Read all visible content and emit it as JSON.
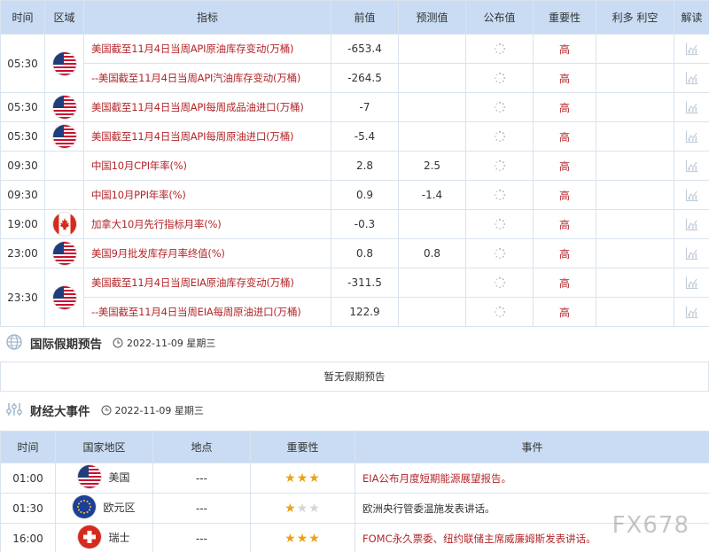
{
  "econ": {
    "headers": [
      "时间",
      "区域",
      "指标",
      "前值",
      "预测值",
      "公布值",
      "重要性",
      "利多 利空",
      "解读"
    ],
    "groups": [
      {
        "time": "05:30",
        "flag": "us-flag",
        "rows": [
          {
            "indicator": "美国截至11月4日当周API原油库存变动(万桶)",
            "prev": "-653.4",
            "forecast": "",
            "importance": "高"
          },
          {
            "indicator": "--美国截至11月4日当周API汽油库存变动(万桶)",
            "prev": "-264.5",
            "forecast": "",
            "importance": "高"
          }
        ]
      },
      {
        "time": "05:30",
        "flag": "us-flag",
        "rows": [
          {
            "indicator": "美国截至11月4日当周API每周成品油进口(万桶)",
            "prev": "-7",
            "forecast": "",
            "importance": "高"
          }
        ]
      },
      {
        "time": "05:30",
        "flag": "us-flag",
        "rows": [
          {
            "indicator": "美国截至11月4日当周API每周原油进口(万桶)",
            "prev": "-5.4",
            "forecast": "",
            "importance": "高"
          }
        ]
      },
      {
        "time": "09:30",
        "flag": "",
        "rows": [
          {
            "indicator": "中国10月CPI年率(%)",
            "prev": "2.8",
            "forecast": "2.5",
            "importance": "高"
          }
        ]
      },
      {
        "time": "09:30",
        "flag": "",
        "rows": [
          {
            "indicator": "中国10月PPI年率(%)",
            "prev": "0.9",
            "forecast": "-1.4",
            "importance": "高"
          }
        ]
      },
      {
        "time": "19:00",
        "flag": "ca-flag",
        "rows": [
          {
            "indicator": "加拿大10月先行指标月率(%)",
            "prev": "-0.3",
            "forecast": "",
            "importance": "高"
          }
        ]
      },
      {
        "time": "23:00",
        "flag": "us-flag",
        "rows": [
          {
            "indicator": "美国9月批发库存月率终值(%)",
            "prev": "0.8",
            "forecast": "0.8",
            "importance": "高"
          }
        ]
      },
      {
        "time": "23:30",
        "flag": "us-flag",
        "rows": [
          {
            "indicator": "美国截至11月4日当周EIA原油库存变动(万桶)",
            "prev": "-311.5",
            "forecast": "",
            "importance": "高"
          },
          {
            "indicator": "--美国截至11月4日当周EIA每周原油进口(万桶)",
            "prev": "122.9",
            "forecast": "",
            "importance": "高"
          }
        ]
      }
    ]
  },
  "holiday": {
    "icon": "globe-icon",
    "title": "国际假期预告",
    "date": "2022-11-09 星期三",
    "empty_text": "暂无假期预告"
  },
  "events": {
    "icon": "sliders-icon",
    "title": "财经大事件",
    "date": "2022-11-09 星期三",
    "headers": [
      "时间",
      "国家地区",
      "地点",
      "重要性",
      "事件"
    ],
    "rows": [
      {
        "time": "01:00",
        "flag": "us-flag",
        "country": "美国",
        "place": "---",
        "stars": 3,
        "event": "EIA公布月度短期能源展望报告。",
        "highlight": true
      },
      {
        "time": "01:30",
        "flag": "eu-flag",
        "country": "欧元区",
        "place": "---",
        "stars": 1,
        "event": "欧洲央行管委温施发表讲话。",
        "highlight": false
      },
      {
        "time": "16:00",
        "flag": "ch-flag",
        "country": "瑞士",
        "place": "---",
        "stars": 3,
        "event": "FOMC永久票委、纽约联储主席威廉姆斯发表讲话。",
        "highlight": true
      }
    ]
  },
  "watermark": "FX678",
  "colors": {
    "header_bg": "#c9dcf3",
    "highlight_red": "#b3262a",
    "star": "#e8a317",
    "border": "#d9e3ef"
  }
}
